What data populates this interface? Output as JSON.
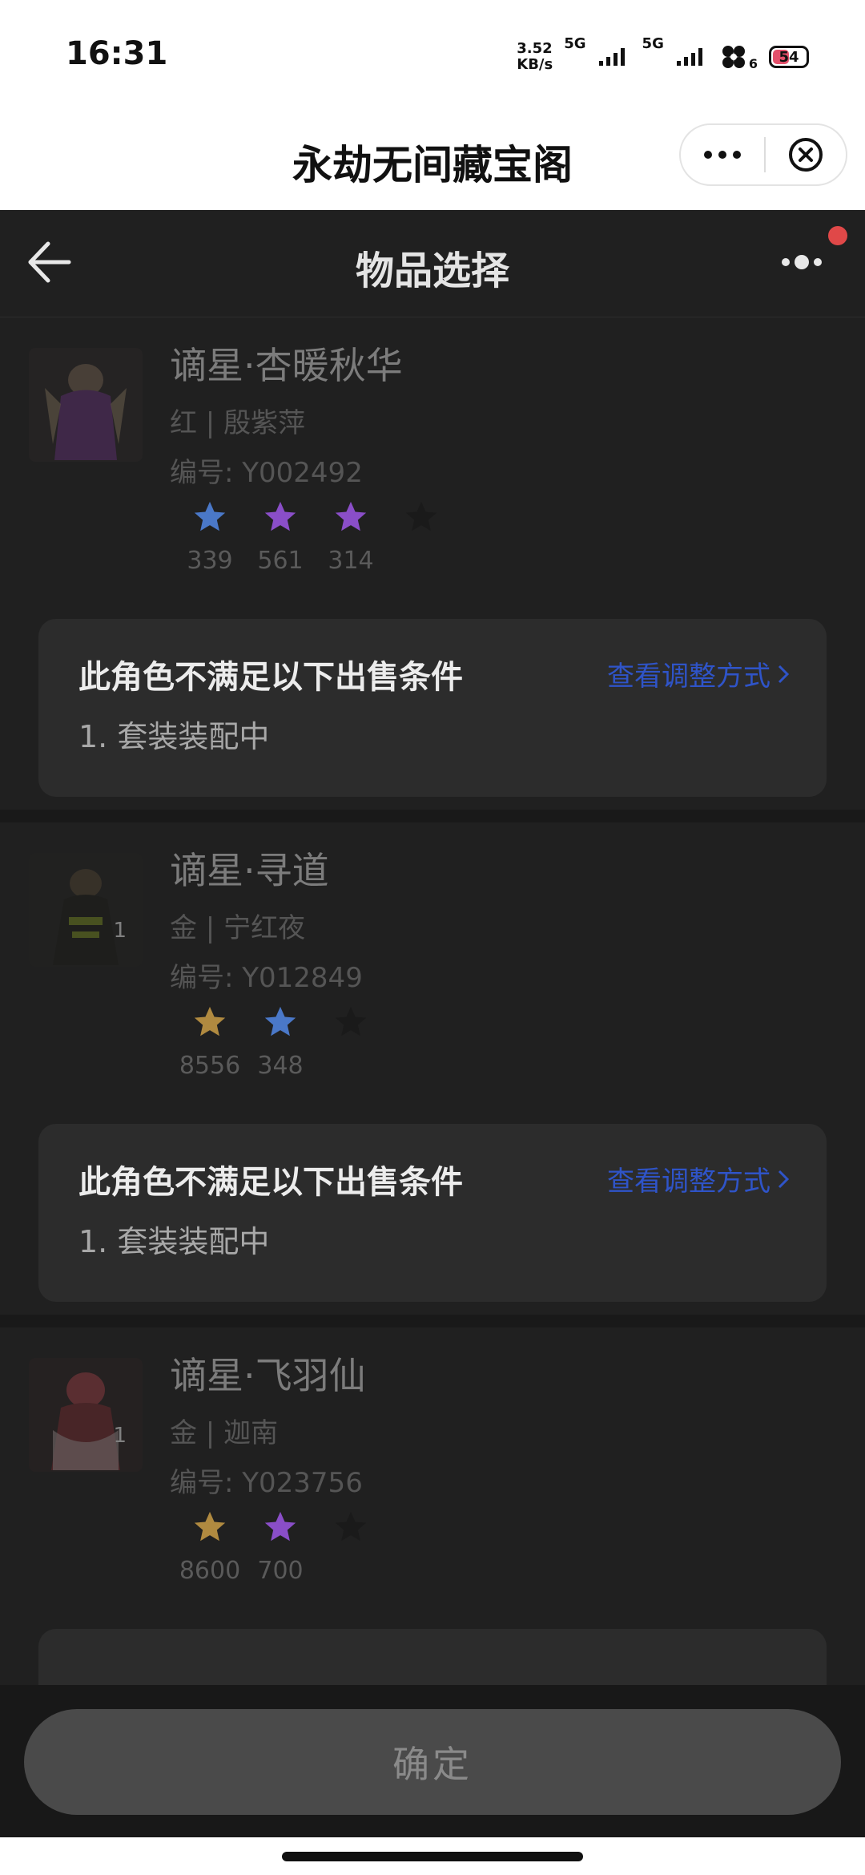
{
  "status_bar": {
    "time": "16:31",
    "net_speed_value": "3.52",
    "net_speed_unit": "KB/s",
    "network_1": "5G",
    "network_2": "5G",
    "fan_count": "6",
    "battery": "54",
    "battery_level": 0.54,
    "battery_color": "#e3506b"
  },
  "mp_header": {
    "title": "永劫无间藏宝阁",
    "more_icon": "more-dots-icon",
    "close_icon": "close-circle-icon"
  },
  "nav": {
    "title": "物品选择",
    "back_icon": "arrow-left-icon",
    "menu_icon": "menu-dots-icon",
    "notification_dot_color": "#e04848"
  },
  "items": [
    {
      "name": "谪星·杏暖秋华",
      "meta": "红 | 殷紫萍",
      "serial": "编号: Y002492",
      "avatar_count": "",
      "stars": [
        {
          "color": "#4a78c8",
          "value": "339"
        },
        {
          "color": "#8a4ec8",
          "value": "561"
        },
        {
          "color": "#8a4ec8",
          "value": "314"
        },
        {
          "color": "#1a1a1a",
          "value": ""
        }
      ],
      "condition": {
        "title": "此角色不满足以下出售条件",
        "link": "查看调整方式",
        "reason": "1. 套装装配中"
      }
    },
    {
      "name": "谪星·寻道",
      "meta": "金 | 宁红夜",
      "serial": "编号: Y012849",
      "avatar_count": "1",
      "stars": [
        {
          "color": "#b08a40",
          "value": "8556"
        },
        {
          "color": "#4a78c8",
          "value": "348"
        },
        {
          "color": "#1a1a1a",
          "value": ""
        }
      ],
      "condition": {
        "title": "此角色不满足以下出售条件",
        "link": "查看调整方式",
        "reason": "1. 套装装配中"
      }
    },
    {
      "name": "谪星·飞羽仙",
      "meta": "金 | 迦南",
      "serial": "编号: Y023756",
      "avatar_count": "1",
      "stars": [
        {
          "color": "#b08a40",
          "value": "8600"
        },
        {
          "color": "#8a4ec8",
          "value": "700"
        },
        {
          "color": "#1a1a1a",
          "value": ""
        }
      ],
      "condition": {
        "title": "",
        "link": "",
        "reason": ""
      }
    }
  ],
  "confirm": {
    "label": "确定"
  }
}
